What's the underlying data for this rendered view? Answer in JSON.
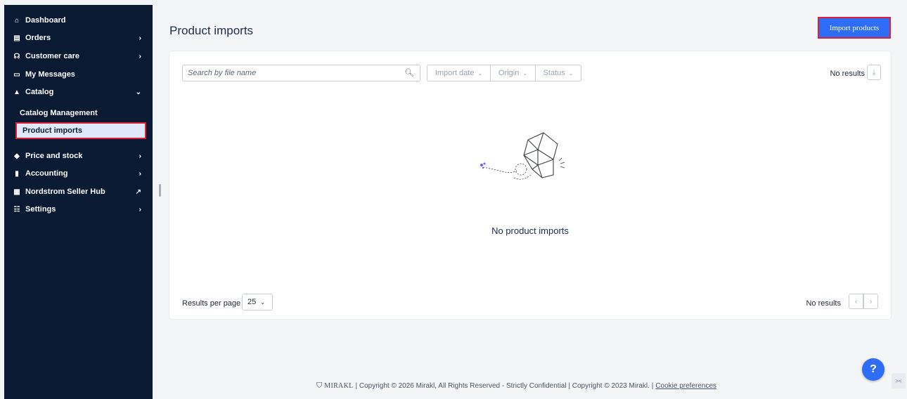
{
  "sidebar": {
    "items": [
      {
        "label": "Dashboard",
        "icon": "home-icon",
        "glyph": "⌂",
        "chevron": ""
      },
      {
        "label": "Orders",
        "icon": "clipboard-icon",
        "glyph": "▤",
        "chevron": "›"
      },
      {
        "label": "Customer care",
        "icon": "headset-icon",
        "glyph": "☊",
        "chevron": "›"
      },
      {
        "label": "My Messages",
        "icon": "message-icon",
        "glyph": "▭",
        "chevron": ""
      },
      {
        "label": "Catalog",
        "icon": "shapes-icon",
        "glyph": "▲",
        "chevron": "⌄"
      },
      {
        "label": "Price and stock",
        "icon": "tag-icon",
        "glyph": "◆",
        "chevron": "›"
      },
      {
        "label": "Accounting",
        "icon": "document-icon",
        "glyph": "▮",
        "chevron": "›"
      },
      {
        "label": "Nordstrom Seller Hub",
        "icon": "grid-icon",
        "glyph": "▦",
        "chevron": "↗"
      },
      {
        "label": "Settings",
        "icon": "sliders-icon",
        "glyph": "☷",
        "chevron": "›"
      }
    ],
    "catalog_sub": [
      {
        "label": "Catalog Management"
      },
      {
        "label": "Product imports"
      }
    ]
  },
  "header": {
    "title": "Product imports",
    "import_button": "Import products"
  },
  "toolbar": {
    "search_placeholder": "Search by file name",
    "filters": [
      "Import date",
      "Origin",
      "Status"
    ],
    "results_text": "No results"
  },
  "empty_state": {
    "message": "No product imports"
  },
  "pagination": {
    "results_per_page_label": "Results per page",
    "per_page_value": "25",
    "results_text": "No results"
  },
  "footer": {
    "brand": "MIRAKL",
    "text": "| Copyright © 2026 Mirakl, All Rights Reserved - Strictly Confidential | Copyright © 2023 Mirakl. |",
    "cookie_link": "Cookie preferences"
  },
  "colors": {
    "sidebar_bg": "#0a1a33",
    "accent": "#2f6df6",
    "highlight_border": "#d9213a",
    "active_item_bg": "#dfe9fb"
  }
}
